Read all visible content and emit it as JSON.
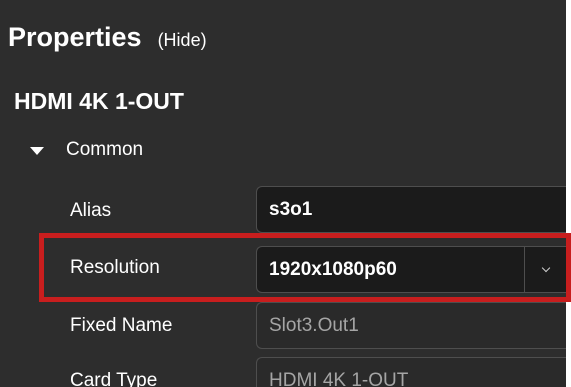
{
  "header": {
    "title": "Properties",
    "hide_label": "(Hide)"
  },
  "device": {
    "title": "HDMI 4K 1-OUT"
  },
  "section": {
    "label": "Common",
    "expanded": true
  },
  "properties": {
    "alias": {
      "label": "Alias",
      "value": "s3o1"
    },
    "resolution": {
      "label": "Resolution",
      "value": "1920x1080p60"
    },
    "fixed_name": {
      "label": "Fixed Name",
      "value": "Slot3.Out1"
    },
    "card_type": {
      "label": "Card Type",
      "value": "HDMI 4K 1-OUT"
    }
  },
  "colors": {
    "panel_background": "#2d2d2d",
    "highlight_border": "#c81e1e",
    "readonly_text": "#a5a5a5"
  }
}
